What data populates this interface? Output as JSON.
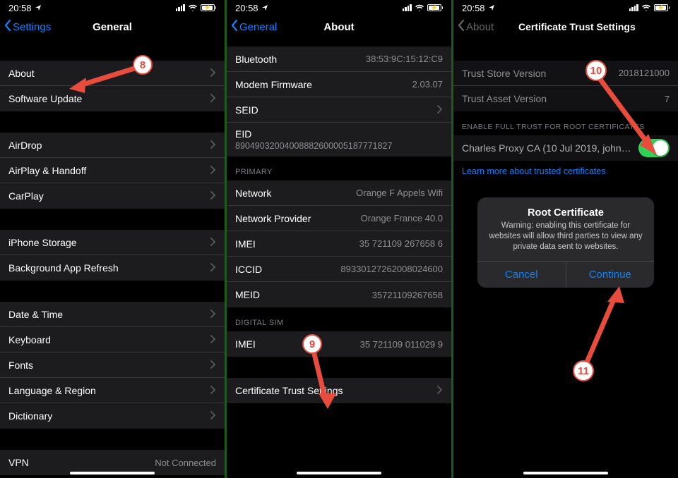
{
  "status": {
    "time": "20:58"
  },
  "screen1": {
    "back": "Settings",
    "title": "General",
    "rows_a": [
      {
        "label": "About"
      },
      {
        "label": "Software Update"
      }
    ],
    "rows_b": [
      {
        "label": "AirDrop"
      },
      {
        "label": "AirPlay & Handoff"
      },
      {
        "label": "CarPlay"
      }
    ],
    "rows_c": [
      {
        "label": "iPhone Storage"
      },
      {
        "label": "Background App Refresh"
      }
    ],
    "rows_d": [
      {
        "label": "Date & Time"
      },
      {
        "label": "Keyboard"
      },
      {
        "label": "Fonts"
      },
      {
        "label": "Language & Region"
      },
      {
        "label": "Dictionary"
      }
    ],
    "rows_e": [
      {
        "label": "VPN",
        "value": "Not Connected"
      }
    ]
  },
  "screen2": {
    "back": "General",
    "title": "About",
    "rows_top": [
      {
        "label": "Bluetooth",
        "value": "38:53:9C:15:12:C9"
      },
      {
        "label": "Modem Firmware",
        "value": "2.03.07"
      },
      {
        "label": "SEID"
      },
      {
        "label": "EID",
        "value": "89049032004008882600005187771827"
      }
    ],
    "primary_header": "PRIMARY",
    "rows_primary": [
      {
        "label": "Network",
        "value": "Orange F Appels Wifi"
      },
      {
        "label": "Network Provider",
        "value": "Orange France 40.0"
      },
      {
        "label": "IMEI",
        "value": "35 721109 267658 6"
      },
      {
        "label": "ICCID",
        "value": "89330127262008024600"
      },
      {
        "label": "MEID",
        "value": "35721109267658"
      }
    ],
    "digital_header": "DIGITAL SIM",
    "rows_digital": [
      {
        "label": "IMEI",
        "value": "35 721109 011029 9"
      }
    ],
    "rows_cert": [
      {
        "label": "Certificate Trust Settings"
      }
    ]
  },
  "screen3": {
    "back": "About",
    "title": "Certificate Trust Settings",
    "rows_top": [
      {
        "label": "Trust Store Version",
        "value": "2018121000"
      },
      {
        "label": "Trust Asset Version",
        "value": "7"
      }
    ],
    "section_header": "ENABLE FULL TRUST FOR ROOT CERTIFICATES",
    "cert_row": {
      "label": "Charles Proxy CA (10 Jul 2019, john…"
    },
    "learn_more": "Learn more about trusted certificates",
    "alert": {
      "title": "Root Certificate",
      "message": "Warning: enabling this certificate for websites will allow third parties to view any private data sent to websites.",
      "cancel": "Cancel",
      "continue": "Continue"
    }
  },
  "annotations": {
    "n8": "8",
    "n9": "9",
    "n10": "10",
    "n11": "11"
  }
}
